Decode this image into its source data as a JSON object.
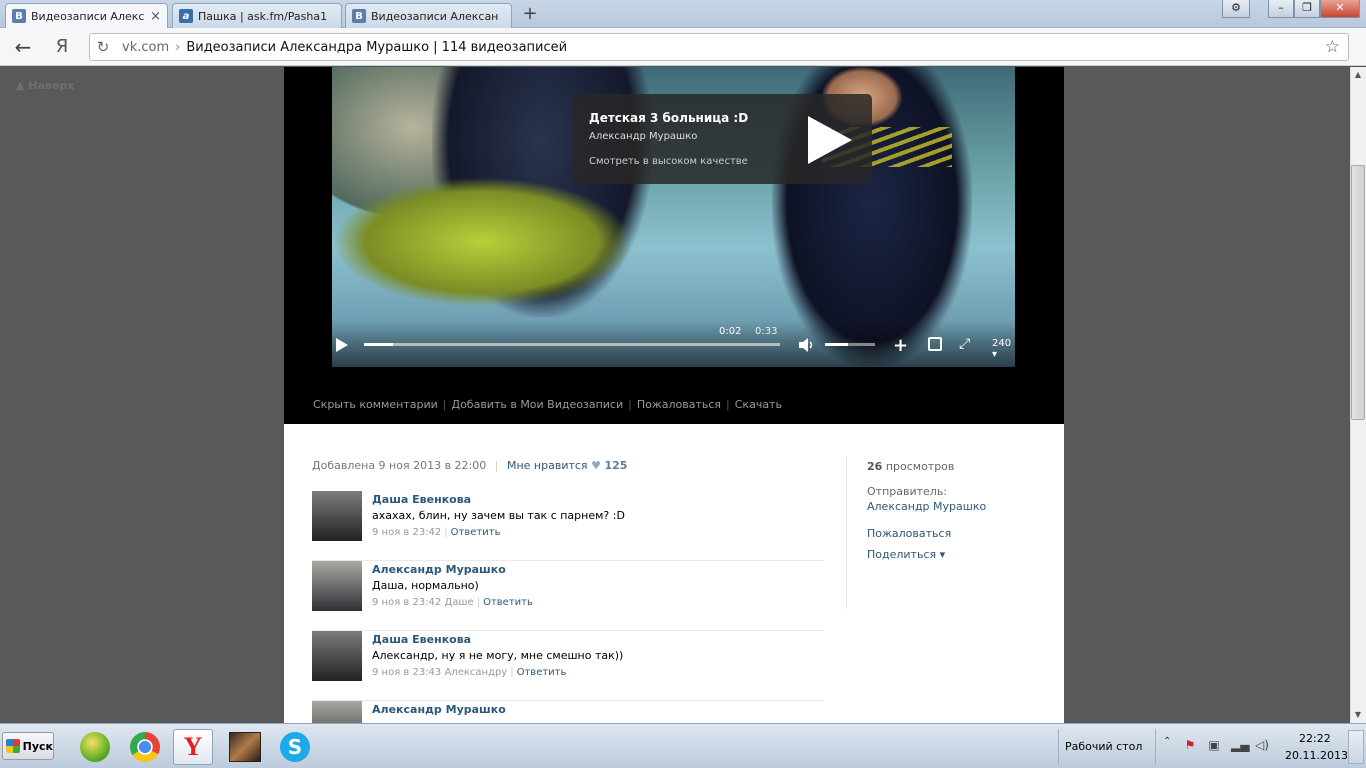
{
  "browser": {
    "tabs": [
      {
        "favicon": "В",
        "title": "Видеозаписи Александ",
        "close": "×"
      },
      {
        "favicon": "a",
        "title": "Пашка | ask.fm/Pasha1",
        "close": ""
      },
      {
        "favicon": "В",
        "title": "Видеозаписи Алексан",
        "close": ""
      }
    ],
    "new_tab": "+",
    "window_buttons": {
      "settings": "⚙",
      "minimize": "–",
      "restore": "❐",
      "close": "✕"
    },
    "nav": {
      "back": "←",
      "yandex": "Я",
      "reload": "↻",
      "star": "☆"
    },
    "address": {
      "host": "vk.com",
      "separator": "›",
      "page_title": "Видеозаписи Александра Мурашко | 114 видеозаписей"
    }
  },
  "page": {
    "to_top": "▲ Наверх",
    "video": {
      "title": "Детская 3 больница :D",
      "author": "Александр Мурашко",
      "hq_link": "Смотреть в высоком качестве",
      "current_time": "0:02",
      "duration": "0:33",
      "quality": "240 ▾",
      "progress": 0.07,
      "volume": 0.45
    },
    "actions": [
      "Скрыть комментарии",
      "Добавить в Мои Видеозаписи",
      "Пожаловаться",
      "Скачать"
    ],
    "meta": {
      "added": "Добавлена 9 ноя 2013 в 22:00",
      "like_label": "Мне нравится",
      "heart": "♥",
      "like_count": "125"
    },
    "comments": [
      {
        "author": "Даша Евенкова",
        "text": "ахахах, блин, ну зачем вы так с парнем? :D",
        "date": "9 ноя в 23:42",
        "reply": "Ответить"
      },
      {
        "author": "Александр Мурашко",
        "text": "Даша, нормально)",
        "date": "9 ноя в 23:42 Даше",
        "reply": "Ответить"
      },
      {
        "author": "Даша Евенкова",
        "text": "Александр, ну я не могу, мне смешно так))",
        "date": "9 ноя в 23:43 Александру",
        "reply": "Ответить"
      },
      {
        "author": "Александр Мурашко",
        "text": "",
        "date": "",
        "reply": ""
      }
    ],
    "sidebar": {
      "views_count": "26",
      "views_label": "просмотров",
      "sender_label": "Отправитель:",
      "sender_name": "Александр Мурашко",
      "report": "Пожаловаться",
      "share": "Поделиться ▾"
    }
  },
  "taskbar": {
    "start": "Пуск",
    "desktop_label": "Рабочий стол",
    "tray_up": "⌃",
    "time": "22:22",
    "date": "20.11.2013"
  },
  "colors": {
    "vk_link": "#2b587a",
    "player_bg": "#000000",
    "page_bg": "#595959"
  }
}
